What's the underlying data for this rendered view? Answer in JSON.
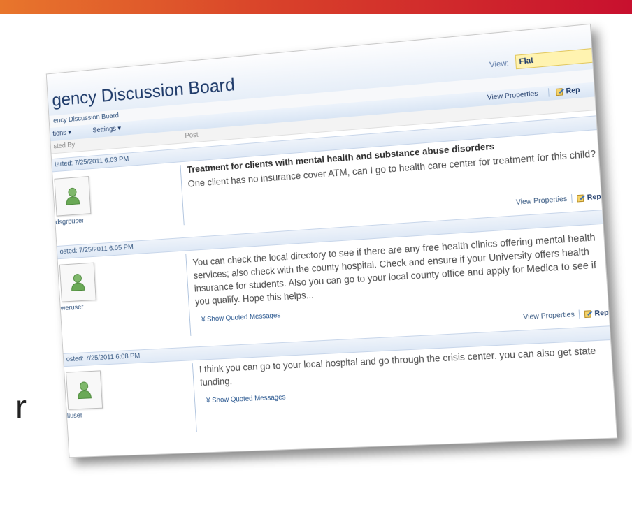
{
  "page": {
    "side_char": "r"
  },
  "board": {
    "title": "gency Discussion Board",
    "breadcrumb": "ency Discussion Board",
    "view_label": "View:",
    "view_value": "Flat"
  },
  "toolbar": {
    "actions_label": "tions ▾",
    "settings_label": "Settings ▾",
    "view_properties": "View Properties",
    "reply": "Rep"
  },
  "columns": {
    "posted_by": "sted By",
    "post": "Post"
  },
  "posts": [
    {
      "date": "tarted: 7/25/2011 6:03 PM",
      "author": "dsgrpuser",
      "subject": "Treatment for clients with mental health and substance abuse disorders",
      "body": "One client has no insurance cover ATM, can I go to health care center for treatment for this child?",
      "view_properties": "View Properties",
      "reply": "Rep"
    },
    {
      "date": "osted: 7/25/2011 6:05 PM",
      "author": "weruser",
      "body": "You can check the local directory to see if there are any free health clinics offering mental health services; also check with the county hospital. Check and ensure if your University offers health insurance for students. Also you can go to your local county office and apply for Medica to see if you qualify. Hope this helps...",
      "quoted": "Show Quoted Messages",
      "view_properties": "View Properties",
      "reply": "Rep"
    },
    {
      "date": "osted: 7/25/2011 6:08 PM",
      "author": "lluser",
      "body": "I think you can go to your local hospital and go through the crisis center. you can also get state funding.",
      "quoted": "Show Quoted Messages"
    }
  ]
}
